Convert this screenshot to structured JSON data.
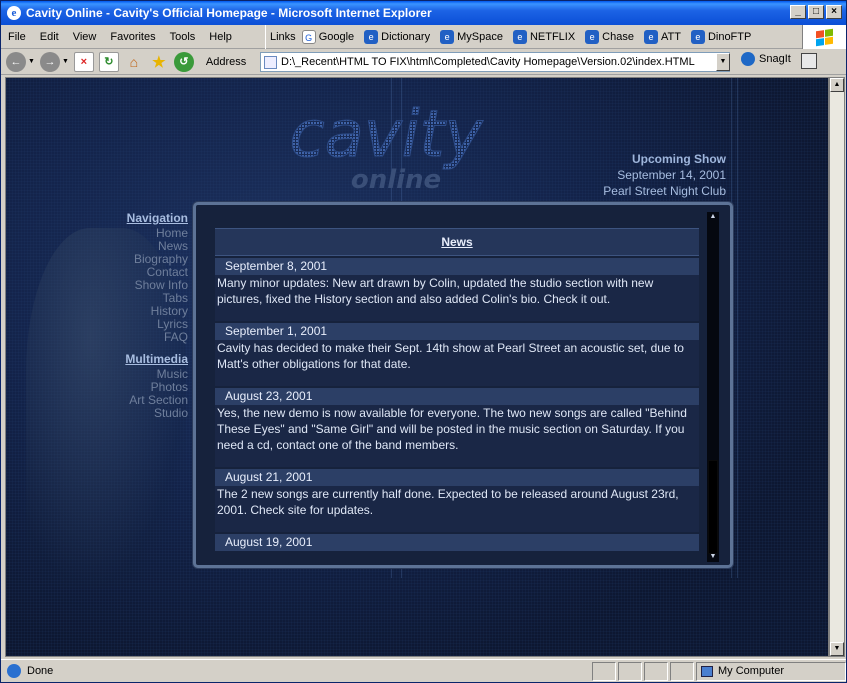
{
  "window": {
    "title": "Cavity Online - Cavity's Official Homepage - Microsoft Internet Explorer",
    "buttons": {
      "minimize": "_",
      "maximize": "□",
      "close": "×"
    }
  },
  "menubar": {
    "items": [
      "File",
      "Edit",
      "View",
      "Favorites",
      "Tools",
      "Help"
    ]
  },
  "links": {
    "label": "Links",
    "items": [
      "Google",
      "Dictionary",
      "MySpace",
      "NETFLIX",
      "Chase",
      "ATT",
      "DinoFTP"
    ]
  },
  "toolbar": {
    "address_label": "Address",
    "address_value": "D:\\_Recent\\HTML TO FIX\\html\\Completed\\Cavity Homepage\\Version.02\\index.HTML",
    "snagit_label": "SnagIt"
  },
  "site": {
    "logo_main": "cavity",
    "logo_sub": "online",
    "upcoming": {
      "title": "Upcoming Show",
      "date": "September 14, 2001",
      "venue": "Pearl Street Night Club"
    },
    "navigation": {
      "heading": "Navigation",
      "items": [
        "Home",
        "News",
        "Biography",
        "Contact",
        "Show Info",
        "Tabs",
        "History",
        "Lyrics",
        "FAQ"
      ]
    },
    "multimedia": {
      "heading": "Multimedia",
      "items": [
        "Music",
        "Photos",
        "Art Section",
        "Studio"
      ]
    },
    "news": {
      "heading": "News",
      "entries": [
        {
          "date": "September 8, 2001",
          "text": "Many minor updates: New art drawn by Colin, updated the studio section with new pictures, fixed the History section and also added Colin's bio. Check it out."
        },
        {
          "date": "September 1, 2001",
          "text": "Cavity has decided to make their Sept. 14th show at Pearl Street an acoustic set, due to Matt's other obligations for that date."
        },
        {
          "date": "August 23, 2001",
          "text": "Yes, the new demo is now available for everyone. The two new songs are called \"Behind These Eyes\" and \"Same Girl\" and will be posted in the music section on Saturday. If you need a cd, contact one of the band members."
        },
        {
          "date": "August 21, 2001",
          "text": "The 2 new songs are currently half done. Expected to be released around August 23rd, 2001. Check site for updates."
        },
        {
          "date": "August 19, 2001",
          "text": ""
        }
      ]
    }
  },
  "status": {
    "text": "Done",
    "zone": "My Computer"
  },
  "colors": {
    "title_bar": "#0b4fd6",
    "page_bg": "#0e1a33",
    "news_date_bg": "#2c3f66",
    "accent_text": "#a7bde0"
  }
}
